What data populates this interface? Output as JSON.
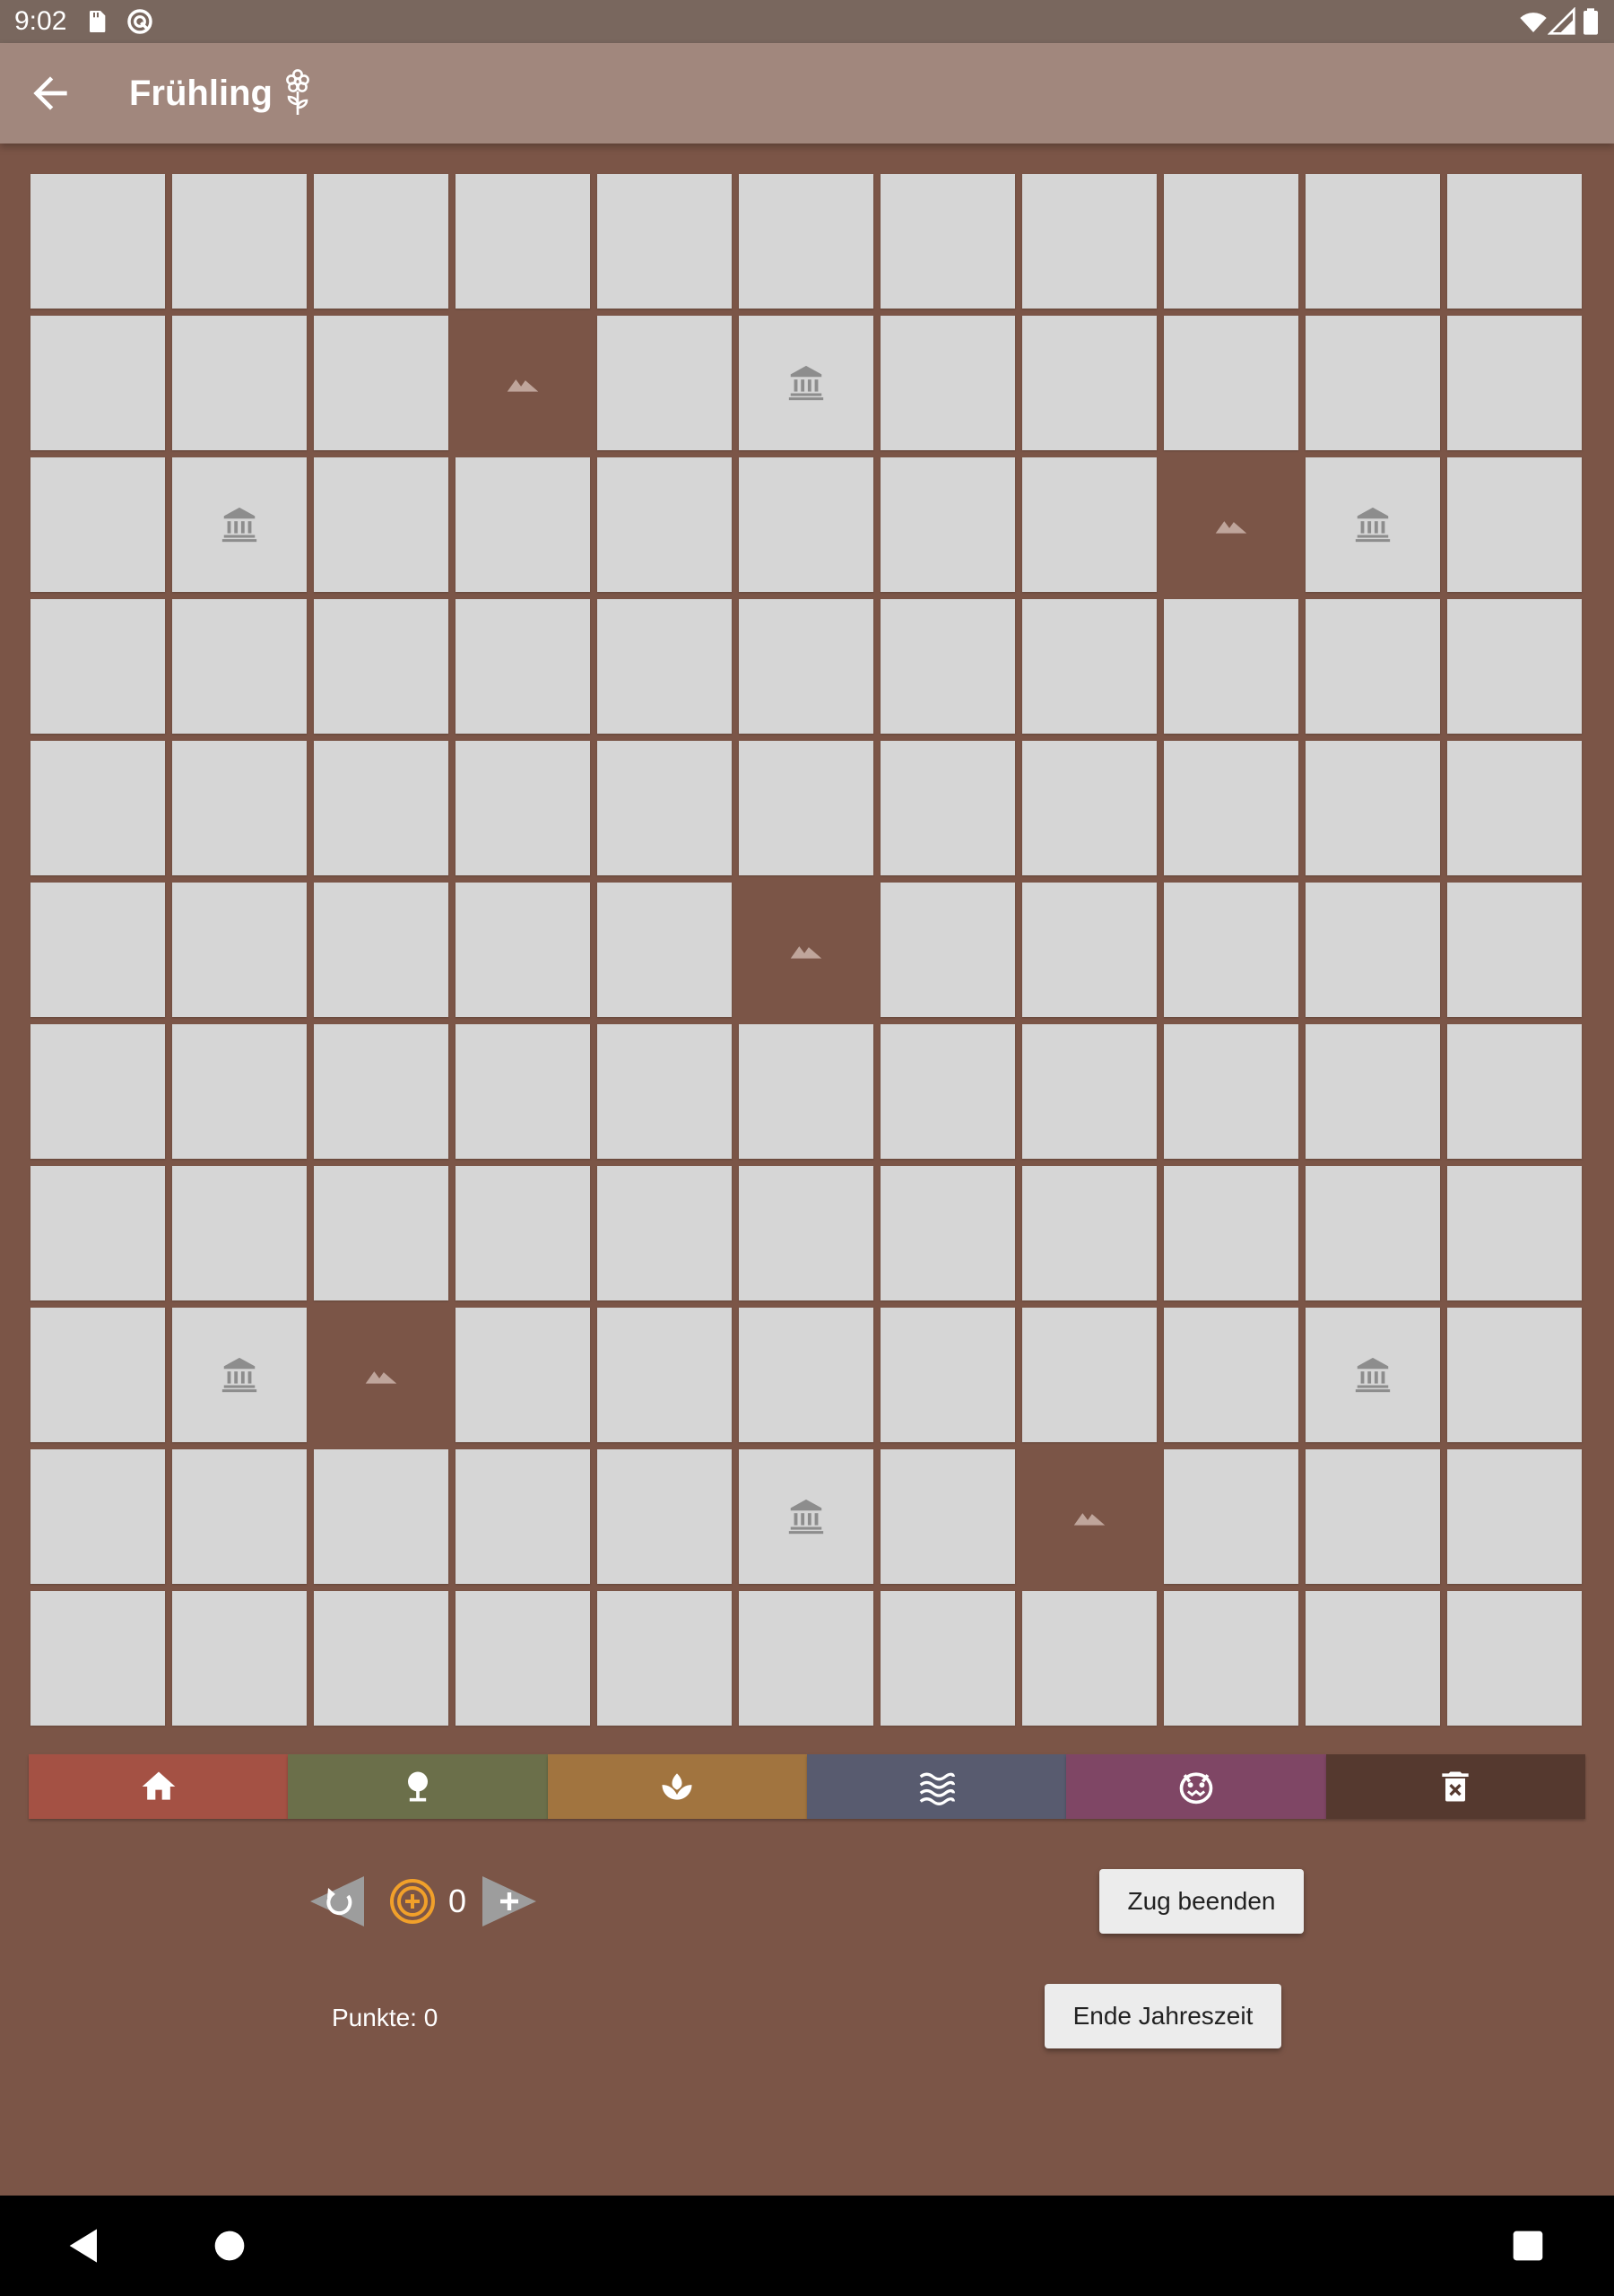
{
  "status_bar": {
    "time": "9:02",
    "left_icons": [
      "sd-card-icon",
      "sync-icon"
    ],
    "right_icons": [
      "wifi-icon",
      "signal-icon",
      "battery-icon"
    ]
  },
  "app_bar": {
    "title": "Frühling",
    "back_icon": "arrow-back-icon",
    "season_icon": "flower-icon"
  },
  "board": {
    "rows": 11,
    "cols": 11,
    "mountains": [
      [
        1,
        3
      ],
      [
        2,
        8
      ],
      [
        5,
        5
      ],
      [
        8,
        2
      ],
      [
        9,
        7
      ]
    ],
    "ruins": [
      [
        1,
        5
      ],
      [
        2,
        1
      ],
      [
        2,
        9
      ],
      [
        8,
        1
      ],
      [
        8,
        9
      ],
      [
        9,
        5
      ]
    ]
  },
  "palette": [
    {
      "name": "village",
      "icon": "house-icon",
      "color": "#a45144"
    },
    {
      "name": "forest",
      "icon": "tree-icon",
      "color": "#6b6f4a"
    },
    {
      "name": "farm",
      "icon": "sprout-icon",
      "color": "#a1743f"
    },
    {
      "name": "water",
      "icon": "waves-icon",
      "color": "#585b6f"
    },
    {
      "name": "monster",
      "icon": "monster-icon",
      "color": "#7f4665"
    },
    {
      "name": "delete",
      "icon": "trash-icon",
      "color": "#55392f"
    }
  ],
  "controls": {
    "coin_count": "0",
    "end_turn_label": "Zug beenden",
    "end_season_label": "Ende Jahreszeit",
    "score_label": "Punkte: 0"
  },
  "colors": {
    "background": "#7b5547",
    "app_bar": "#a1877d",
    "status_bar": "#79675e",
    "cell": "#d6d6d6",
    "coin": "#f1a02a"
  }
}
